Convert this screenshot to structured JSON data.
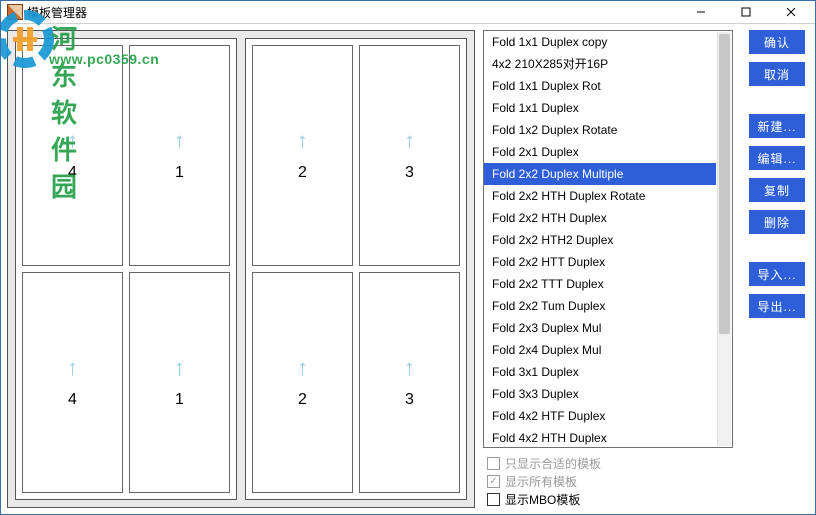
{
  "window": {
    "title": "模板管理器",
    "controls": {
      "min": "min",
      "max": "max",
      "close": "close"
    }
  },
  "preview": {
    "spreads": [
      {
        "cells": [
          {
            "num": "4",
            "dir": "up"
          },
          {
            "num": "1",
            "dir": "up"
          },
          {
            "num": "4",
            "dir": "up"
          },
          {
            "num": "1",
            "dir": "up"
          }
        ]
      },
      {
        "cells": [
          {
            "num": "2",
            "dir": "up"
          },
          {
            "num": "3",
            "dir": "up"
          },
          {
            "num": "2",
            "dir": "up"
          },
          {
            "num": "3",
            "dir": "up"
          }
        ]
      }
    ]
  },
  "templates": {
    "selected_index": 6,
    "items": [
      "Fold 1x1 Duplex copy",
      "4x2 210X285对开16P",
      "Fold 1x1 Duplex Rot",
      "Fold 1x1 Duplex",
      "Fold 1x2 Duplex Rotate",
      "Fold 2x1 Duplex",
      "Fold 2x2 Duplex Multiple",
      "Fold 2x2 HTH Duplex Rotate",
      "Fold 2x2 HTH Duplex",
      "Fold 2x2 HTH2 Duplex",
      "Fold 2x2 HTT Duplex",
      "Fold 2x2 TTT Duplex",
      "Fold 2x2 Tum Duplex",
      "Fold 2x3 Duplex Mul",
      "Fold 2x4 Duplex Mul",
      "Fold 3x1 Duplex",
      "Fold 3x3 Duplex",
      "Fold 4x2 HTF Duplex",
      "Fold 4x2 HTH Duplex"
    ]
  },
  "checks": {
    "only_fit": {
      "label": "只显示合适的模板",
      "checked": false,
      "enabled": false
    },
    "show_all": {
      "label": "显示所有模板",
      "checked": true,
      "enabled": false
    },
    "show_mbo": {
      "label": "显示MBO模板",
      "checked": false,
      "enabled": true
    }
  },
  "buttons": {
    "ok": "确认",
    "cancel": "取消",
    "new": "新建...",
    "edit": "编辑...",
    "copy": "复制",
    "delete": "删除",
    "import": "导入...",
    "export": "导出..."
  },
  "watermark": {
    "text": "河东软件园",
    "url": "www.pc0359.cn"
  }
}
